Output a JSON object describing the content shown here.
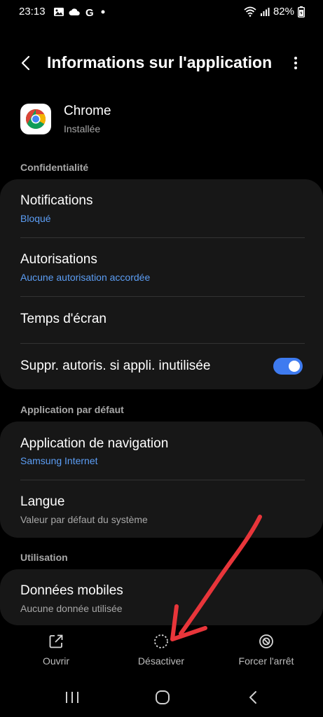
{
  "status_bar": {
    "time": "23:13",
    "battery": "82%",
    "left_icons": [
      "image-icon",
      "cloud-icon",
      "google-icon",
      "dot-icon"
    ],
    "right_icons": [
      "wifi-icon",
      "signal-icon",
      "battery-icon"
    ]
  },
  "header": {
    "title": "Informations sur l'application",
    "back_icon": "chevron-left-icon",
    "more_icon": "more-vert-icon"
  },
  "app": {
    "name": "Chrome",
    "status": "Installée"
  },
  "sections": {
    "privacy": {
      "title": "Confidentialité",
      "items": [
        {
          "title": "Notifications",
          "subtitle": "Bloqué"
        },
        {
          "title": "Autorisations",
          "subtitle": "Aucune autorisation accordée"
        },
        {
          "title": "Temps d'écran"
        },
        {
          "title": "Suppr. autoris. si appli. inutilisée",
          "toggle_on": true
        }
      ]
    },
    "default_app": {
      "title": "Application par défaut",
      "items": [
        {
          "title": "Application de navigation",
          "subtitle": "Samsung Internet"
        },
        {
          "title": "Langue",
          "subtitle": "Valeur par défaut du système"
        }
      ]
    },
    "usage": {
      "title": "Utilisation",
      "items": [
        {
          "title": "Données mobiles",
          "subtitle": "Aucune donnée utilisée"
        }
      ]
    }
  },
  "actions": {
    "open": "Ouvrir",
    "disable": "Désactiver",
    "force_stop": "Forcer l'arrêt"
  },
  "nav": {
    "icons": [
      "recents-icon",
      "home-icon",
      "back-icon"
    ]
  },
  "colors": {
    "accent": "#5c9ef5",
    "toggle": "#3e7bf0",
    "card": "#171717",
    "annotation_arrow": "#e8353a"
  }
}
